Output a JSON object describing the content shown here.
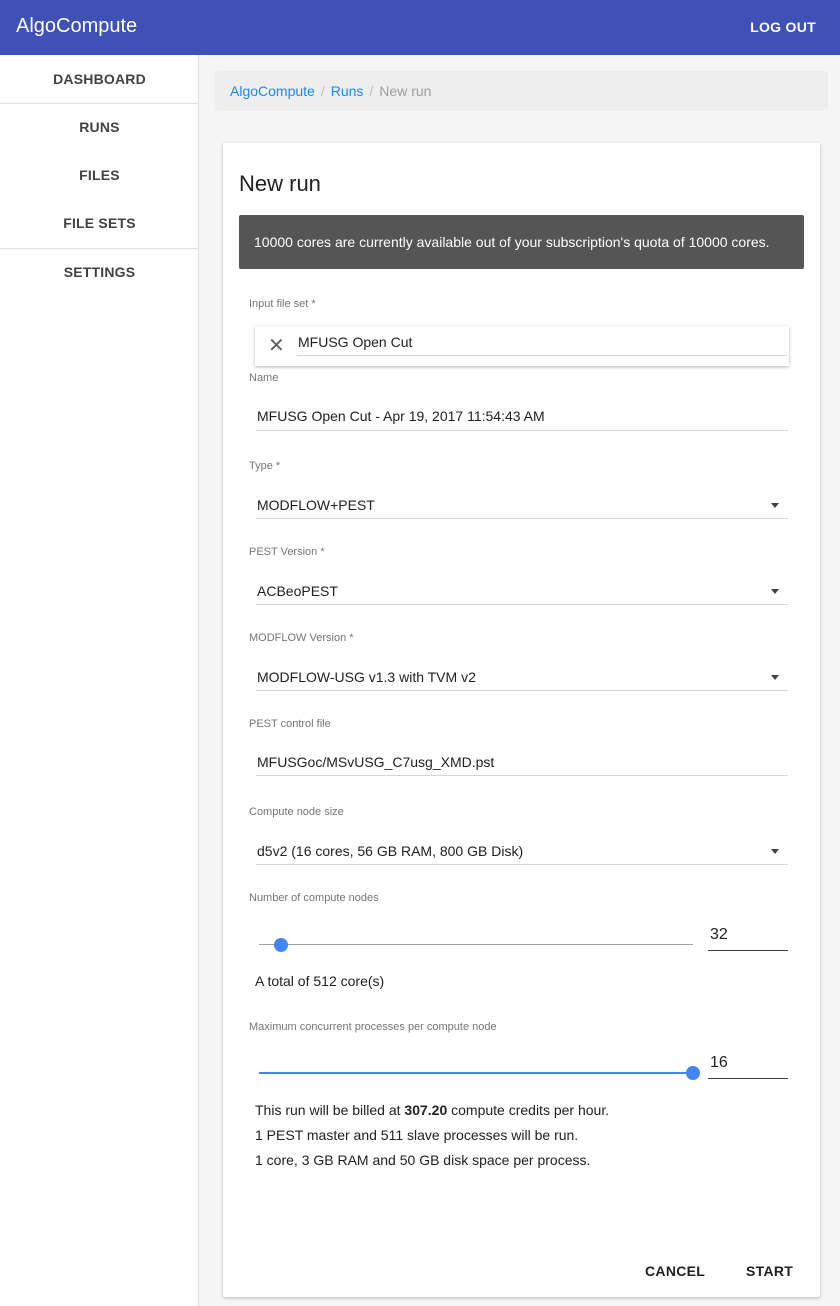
{
  "app": {
    "title": "AlgoCompute",
    "logout_label": "LOG OUT"
  },
  "sidebar": {
    "items": [
      {
        "label": "DASHBOARD"
      },
      {
        "label": "RUNS"
      },
      {
        "label": "FILES"
      },
      {
        "label": "FILE SETS"
      },
      {
        "label": "SETTINGS"
      }
    ]
  },
  "breadcrumb": {
    "items": [
      "AlgoCompute",
      "Runs"
    ],
    "current": "New run",
    "separator": "/"
  },
  "form": {
    "title": "New run",
    "banner": "10000 cores are currently available out of your subscription's quota of 10000 cores.",
    "input_file_set": {
      "label": "Input file set *",
      "value": "MFUSG Open Cut"
    },
    "name": {
      "label": "Name",
      "value": "MFUSG Open Cut - Apr 19, 2017 11:54:43 AM"
    },
    "type": {
      "label": "Type *",
      "value": "MODFLOW+PEST"
    },
    "pest_version": {
      "label": "PEST Version *",
      "value": "ACBeoPEST"
    },
    "modflow_version": {
      "label": "MODFLOW Version *",
      "value": "MODFLOW-USG v1.3 with TVM v2"
    },
    "pest_control_file": {
      "label": "PEST control file",
      "value": "MFUSGoc/MSvUSG_C7usg_XMD.pst"
    },
    "compute_node_size": {
      "label": "Compute node size",
      "value": "d5v2 (16 cores, 56 GB RAM, 800 GB Disk)"
    },
    "num_nodes": {
      "label": "Number of compute nodes",
      "value": "32",
      "slider_fraction": 0.05,
      "total_text": "A total of 512 core(s)"
    },
    "max_processes": {
      "label": "Maximum concurrent processes per compute node",
      "value": "16",
      "slider_fraction": 1.0
    },
    "billing": {
      "prefix": "This run will be billed at ",
      "amount": "307.20",
      "suffix": " compute credits per hour."
    },
    "processes_text": "1 PEST master and 511 slave processes will be run.",
    "resources_text": "1 core, 3 GB RAM and 50 GB disk space per process.",
    "cancel_label": "CANCEL",
    "start_label": "START"
  },
  "icons": {
    "clear": "close-icon",
    "dropdown": "caret-down-icon"
  },
  "colors": {
    "appbar": "#3f51b5",
    "accent": "#4285f4",
    "link": "#1e88e5",
    "banner": "#555555"
  }
}
